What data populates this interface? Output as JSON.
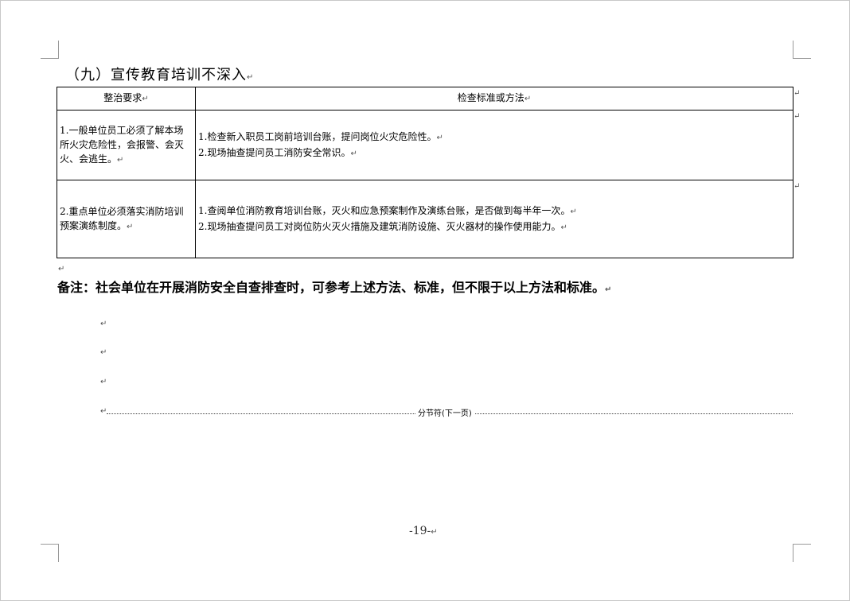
{
  "heading": "（九）宣传教育培训不深入",
  "para_mark": "↵",
  "table": {
    "headers": [
      "整治要求",
      "检查标准或方法"
    ],
    "rows": [
      {
        "requirement": "1.一般单位员工必须了解本场所火灾危险性，会报警、会灭火、会逃生。",
        "methods": [
          "1.检查新入职员工岗前培训台账，提问岗位火灾危险性。",
          "2.现场抽查提问员工消防安全常识。"
        ]
      },
      {
        "requirement": "2.重点单位必须落实消防培训预案演练制度。",
        "methods": [
          "1.查阅单位消防教育培训台账，灭火和应急预案制作及演练台账，是否做到每半年一次。",
          "2.现场抽查提问员工对岗位防火灭火措施及建筑消防设施、灭火器材的操作使用能力。"
        ]
      }
    ]
  },
  "note": "备注：社会单位在开展消防安全自查排查时，可参考上述方法、标准，但不限于以上方法和标准。",
  "section_break": "分节符(下一页)",
  "page_number": "-19-"
}
